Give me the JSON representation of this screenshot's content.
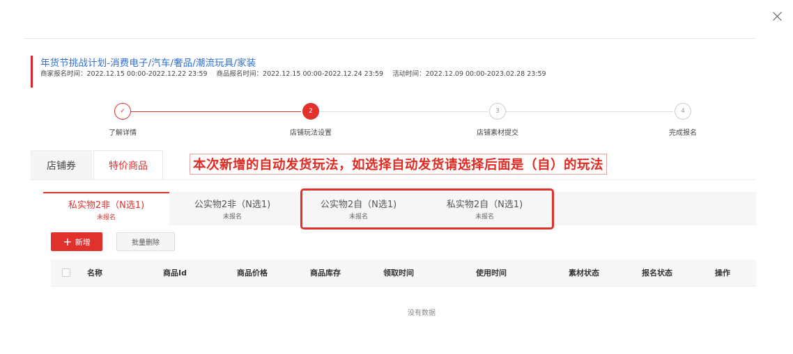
{
  "activity": {
    "title": "年货节挑战计划-消费电子/汽车/奢品/潮流玩具/家装",
    "merchant_signup": "商家报名时间：2022.12.15 00:00-2022.12.22 23:59",
    "product_signup": "商品报名时间：2022.12.15 00:00-2022.12.24 23:59",
    "activity_time": "活动时间：2022.12.09 00:00-2023.02.28 23:59"
  },
  "steps": [
    {
      "number": "✓",
      "label": "了解详情",
      "state": "done"
    },
    {
      "number": "2",
      "label": "店铺玩法设置",
      "state": "active"
    },
    {
      "number": "3",
      "label": "店铺素材提交",
      "state": "todo"
    },
    {
      "number": "4",
      "label": "完成报名",
      "state": "todo"
    }
  ],
  "tabs": [
    {
      "label": "店铺券"
    },
    {
      "label": "特价商品"
    }
  ],
  "notice": "本次新增的自动发货玩法，如选择自动发货请选择后面是（自）的玩法",
  "subtabs": [
    {
      "name": "私实物2非（N选1)",
      "status": "未报名"
    },
    {
      "name": "公实物2非（N选1)",
      "status": "未报名"
    },
    {
      "name": "公实物2自（N选1)",
      "status": "未报名"
    },
    {
      "name": "私实物2自（N选1)",
      "status": "未报名"
    }
  ],
  "buttons": {
    "add": "新增",
    "batch_delete": "批量删除"
  },
  "table": {
    "columns": [
      "名称",
      "商品Id",
      "商品价格",
      "商品库存",
      "领取时间",
      "使用时间",
      "素材状态",
      "报名状态",
      "操作"
    ],
    "empty_text": "没有数据"
  },
  "colors": {
    "brand_red": "#e0312d",
    "link_blue": "#2f6fd1"
  }
}
